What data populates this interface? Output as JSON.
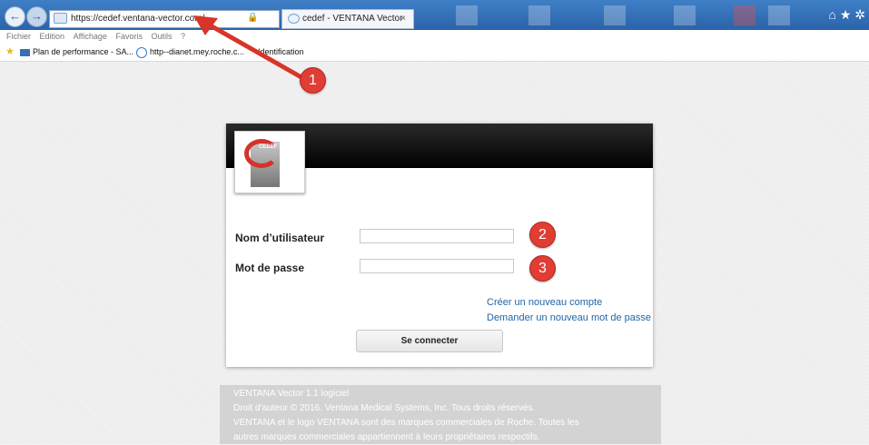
{
  "browser": {
    "address": "https://cedef.ventana-vector.com/",
    "address_controls": "ρ ▾ 🔒 ↻",
    "tab_title": "cedef - VENTANA Vector",
    "tab_close": "×",
    "back_icon": "arrow-left",
    "forward_icon": "arrow-right",
    "menu": [
      "Fichier",
      "Edition",
      "Affichage",
      "Favoris",
      "Outils",
      "?"
    ],
    "favorites": [
      {
        "label": "Plan de performance - SA...",
        "icon": "sap-icon"
      },
      {
        "label": "http--dianet.mey.roche.c...",
        "icon": "ie-page-icon"
      },
      {
        "label": "Identification",
        "icon": "page-icon"
      }
    ],
    "toolbar_icons": "⌂ ★ ✲"
  },
  "login": {
    "username_label": "Nom d’utilisateur",
    "password_label": "Mot de passe",
    "username_value": "",
    "password_value": "",
    "create_account_link": "Créer un nouveau compte",
    "reset_password_link": "Demander un nouveau mot de passe",
    "submit_label": "Se connecter",
    "logo_text": "CEDEF"
  },
  "annotations": {
    "badge1": "1",
    "badge2": "2",
    "badge3": "3",
    "arrow_color": "#d9342b"
  },
  "footer": {
    "lines": [
      "VENTANA Vector 1.1 logiciel",
      "Droit d’auteur © 2016. Ventana Medical Systems, Inc. Tous droits réservés.",
      "VENTANA et le logo VENTANA sont des marques commerciales de Roche. Toutes les",
      "autres marques commerciales appartiennent à leurs propriétaires respectifs."
    ]
  }
}
